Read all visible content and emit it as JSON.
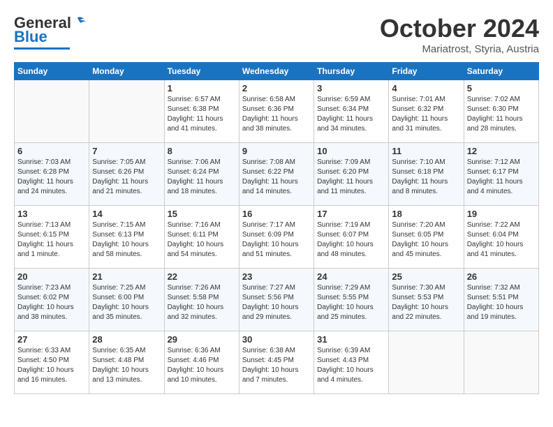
{
  "header": {
    "logo_general": "General",
    "logo_blue": "Blue",
    "month": "October 2024",
    "location": "Mariatrost, Styria, Austria"
  },
  "days_of_week": [
    "Sunday",
    "Monday",
    "Tuesday",
    "Wednesday",
    "Thursday",
    "Friday",
    "Saturday"
  ],
  "weeks": [
    [
      {
        "day": "",
        "info": ""
      },
      {
        "day": "",
        "info": ""
      },
      {
        "day": "1",
        "info": "Sunrise: 6:57 AM\nSunset: 6:38 PM\nDaylight: 11 hours and 41 minutes."
      },
      {
        "day": "2",
        "info": "Sunrise: 6:58 AM\nSunset: 6:36 PM\nDaylight: 11 hours and 38 minutes."
      },
      {
        "day": "3",
        "info": "Sunrise: 6:59 AM\nSunset: 6:34 PM\nDaylight: 11 hours and 34 minutes."
      },
      {
        "day": "4",
        "info": "Sunrise: 7:01 AM\nSunset: 6:32 PM\nDaylight: 11 hours and 31 minutes."
      },
      {
        "day": "5",
        "info": "Sunrise: 7:02 AM\nSunset: 6:30 PM\nDaylight: 11 hours and 28 minutes."
      }
    ],
    [
      {
        "day": "6",
        "info": "Sunrise: 7:03 AM\nSunset: 6:28 PM\nDaylight: 11 hours and 24 minutes."
      },
      {
        "day": "7",
        "info": "Sunrise: 7:05 AM\nSunset: 6:26 PM\nDaylight: 11 hours and 21 minutes."
      },
      {
        "day": "8",
        "info": "Sunrise: 7:06 AM\nSunset: 6:24 PM\nDaylight: 11 hours and 18 minutes."
      },
      {
        "day": "9",
        "info": "Sunrise: 7:08 AM\nSunset: 6:22 PM\nDaylight: 11 hours and 14 minutes."
      },
      {
        "day": "10",
        "info": "Sunrise: 7:09 AM\nSunset: 6:20 PM\nDaylight: 11 hours and 11 minutes."
      },
      {
        "day": "11",
        "info": "Sunrise: 7:10 AM\nSunset: 6:18 PM\nDaylight: 11 hours and 8 minutes."
      },
      {
        "day": "12",
        "info": "Sunrise: 7:12 AM\nSunset: 6:17 PM\nDaylight: 11 hours and 4 minutes."
      }
    ],
    [
      {
        "day": "13",
        "info": "Sunrise: 7:13 AM\nSunset: 6:15 PM\nDaylight: 11 hours and 1 minute."
      },
      {
        "day": "14",
        "info": "Sunrise: 7:15 AM\nSunset: 6:13 PM\nDaylight: 10 hours and 58 minutes."
      },
      {
        "day": "15",
        "info": "Sunrise: 7:16 AM\nSunset: 6:11 PM\nDaylight: 10 hours and 54 minutes."
      },
      {
        "day": "16",
        "info": "Sunrise: 7:17 AM\nSunset: 6:09 PM\nDaylight: 10 hours and 51 minutes."
      },
      {
        "day": "17",
        "info": "Sunrise: 7:19 AM\nSunset: 6:07 PM\nDaylight: 10 hours and 48 minutes."
      },
      {
        "day": "18",
        "info": "Sunrise: 7:20 AM\nSunset: 6:05 PM\nDaylight: 10 hours and 45 minutes."
      },
      {
        "day": "19",
        "info": "Sunrise: 7:22 AM\nSunset: 6:04 PM\nDaylight: 10 hours and 41 minutes."
      }
    ],
    [
      {
        "day": "20",
        "info": "Sunrise: 7:23 AM\nSunset: 6:02 PM\nDaylight: 10 hours and 38 minutes."
      },
      {
        "day": "21",
        "info": "Sunrise: 7:25 AM\nSunset: 6:00 PM\nDaylight: 10 hours and 35 minutes."
      },
      {
        "day": "22",
        "info": "Sunrise: 7:26 AM\nSunset: 5:58 PM\nDaylight: 10 hours and 32 minutes."
      },
      {
        "day": "23",
        "info": "Sunrise: 7:27 AM\nSunset: 5:56 PM\nDaylight: 10 hours and 29 minutes."
      },
      {
        "day": "24",
        "info": "Sunrise: 7:29 AM\nSunset: 5:55 PM\nDaylight: 10 hours and 25 minutes."
      },
      {
        "day": "25",
        "info": "Sunrise: 7:30 AM\nSunset: 5:53 PM\nDaylight: 10 hours and 22 minutes."
      },
      {
        "day": "26",
        "info": "Sunrise: 7:32 AM\nSunset: 5:51 PM\nDaylight: 10 hours and 19 minutes."
      }
    ],
    [
      {
        "day": "27",
        "info": "Sunrise: 6:33 AM\nSunset: 4:50 PM\nDaylight: 10 hours and 16 minutes."
      },
      {
        "day": "28",
        "info": "Sunrise: 6:35 AM\nSunset: 4:48 PM\nDaylight: 10 hours and 13 minutes."
      },
      {
        "day": "29",
        "info": "Sunrise: 6:36 AM\nSunset: 4:46 PM\nDaylight: 10 hours and 10 minutes."
      },
      {
        "day": "30",
        "info": "Sunrise: 6:38 AM\nSunset: 4:45 PM\nDaylight: 10 hours and 7 minutes."
      },
      {
        "day": "31",
        "info": "Sunrise: 6:39 AM\nSunset: 4:43 PM\nDaylight: 10 hours and 4 minutes."
      },
      {
        "day": "",
        "info": ""
      },
      {
        "day": "",
        "info": ""
      }
    ]
  ]
}
